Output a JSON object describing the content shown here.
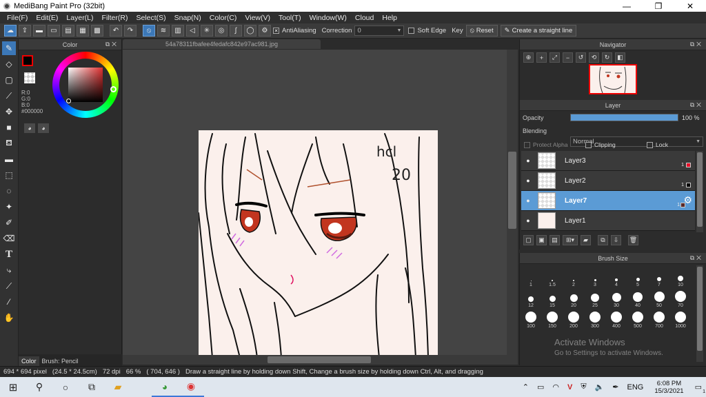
{
  "window": {
    "title": "MediBang Paint Pro (32bit)",
    "minimize": "—",
    "maximize": "❐",
    "close": "✕"
  },
  "menu": [
    "File(F)",
    "Edit(E)",
    "Layer(L)",
    "Filter(R)",
    "Select(S)",
    "Snap(N)",
    "Color(C)",
    "View(V)",
    "Tool(T)",
    "Window(W)",
    "Cloud",
    "Help"
  ],
  "toolbar": {
    "antialiasing_label": "AntiAliasing",
    "correction_label": "Correction",
    "correction_value": "0",
    "soft_edge_label": "Soft Edge",
    "key_label": "Key",
    "reset_label": "Reset",
    "straight_line_label": "Create a straight line"
  },
  "color_panel": {
    "title": "Color",
    "r": "R:0",
    "g": "G:0",
    "b": "B:0",
    "hex": "#000000",
    "foreground": "#000000",
    "wheel_indicator": "#ff2a2a"
  },
  "canvas": {
    "tab_title": "54a78311fbafee4fedafc842e97ac981.jpg",
    "paper_color": "#fbf0ec",
    "sketch_text_1": "hcl",
    "sketch_text_2": "20"
  },
  "navigator": {
    "title": "Navigator"
  },
  "layer_panel": {
    "title": "Layer",
    "opacity_label": "Opacity",
    "opacity_value": "100 %",
    "opacity_fraction": 1.0,
    "blending_label": "Blending",
    "blending_value": "Normal",
    "protect_alpha": "Protect Alpha",
    "clipping": "Clipping",
    "lock": "Lock",
    "layers": [
      {
        "name": "Layer3",
        "count": "1",
        "swatch": "#e8102a",
        "selected": false
      },
      {
        "name": "Layer2",
        "count": "1",
        "swatch": "#000000",
        "selected": false
      },
      {
        "name": "Layer7",
        "count": "1",
        "swatch": "#5a2a2a",
        "selected": true
      },
      {
        "name": "Layer1",
        "count": "",
        "swatch": "",
        "selected": false
      }
    ]
  },
  "brush_panel": {
    "title": "Brush Size",
    "sizes": [
      "1",
      "1.5",
      "2",
      "3",
      "4",
      "5",
      "7",
      "10",
      "12",
      "15",
      "20",
      "25",
      "30",
      "40",
      "50",
      "70",
      "100",
      "150",
      "200",
      "300",
      "400",
      "500",
      "700",
      "1000"
    ]
  },
  "bottom_tabs": [
    "Color",
    "Brush: Pencil"
  ],
  "status": {
    "size": "694 * 694 pixel",
    "size_cm": "(24.5 * 24.5cm)",
    "dpi": "72 dpi",
    "zoom": "66 %",
    "coords": "( 704, 646 )",
    "hint": "Draw a straight line by holding down Shift, Change a brush size by holding down Ctrl, Alt, and dragging"
  },
  "watermark": {
    "line1": "Activate Windows",
    "line2": "Go to Settings to activate Windows."
  },
  "taskbar": {
    "lang": "ENG",
    "time": "6:08 PM",
    "date": "15/3/2021",
    "notification_count": "1"
  }
}
